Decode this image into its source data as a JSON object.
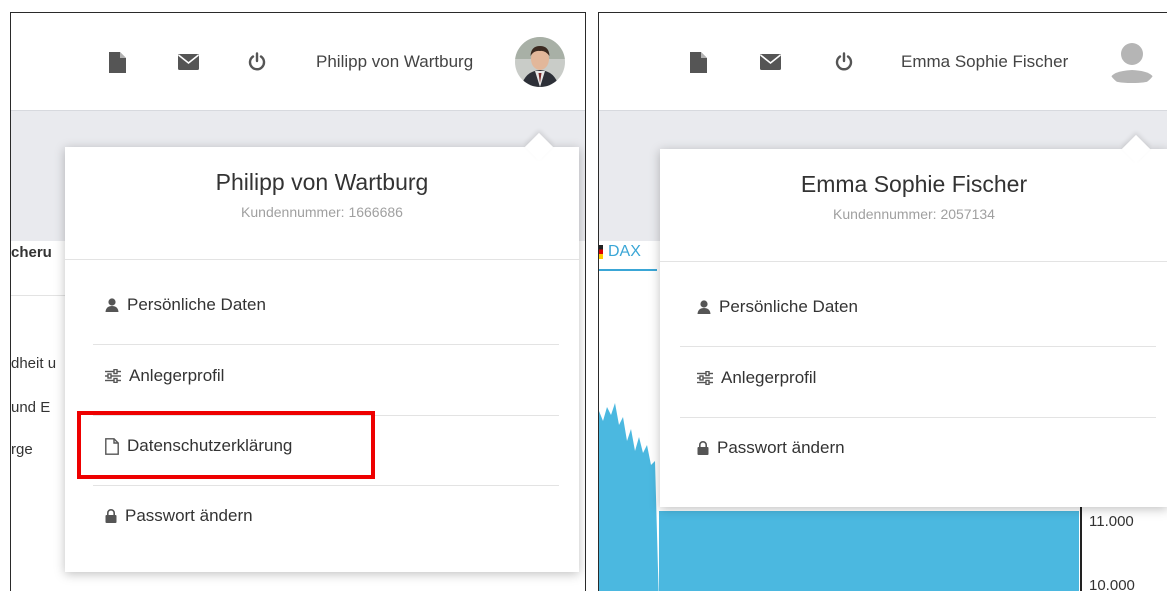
{
  "left": {
    "user_name": "Philipp von Wartburg",
    "dropdown": {
      "name": "Philipp von Wartburg",
      "customer_number": "Kundennummer: 1666686",
      "items": [
        {
          "label": "Persönliche Daten",
          "icon": "user-icon"
        },
        {
          "label": "Anlegerprofil",
          "icon": "sliders-icon"
        },
        {
          "label": "Datenschutzerklärung",
          "icon": "document-outline-icon",
          "highlighted": true
        },
        {
          "label": "Passwort ändern",
          "icon": "lock-icon"
        }
      ]
    },
    "background_fragments": [
      "cheru",
      "dheit u",
      "und E",
      "rge"
    ]
  },
  "right": {
    "user_name": "Emma Sophie Fischer",
    "dropdown": {
      "name": "Emma Sophie Fischer",
      "customer_number": "Kundennummer: 2057134",
      "items": [
        {
          "label": "Persönliche Daten",
          "icon": "user-icon"
        },
        {
          "label": "Anlegerprofil",
          "icon": "sliders-icon"
        },
        {
          "label": "Passwort ändern",
          "icon": "lock-icon"
        }
      ]
    },
    "tab_label": "DAX",
    "y_ticks": [
      "11.000",
      "10.000"
    ]
  },
  "colors": {
    "highlight": "#ee0000",
    "chart_fill": "#4bb8e0",
    "tab_underline": "#3aa6d6",
    "icon": "#555555"
  }
}
